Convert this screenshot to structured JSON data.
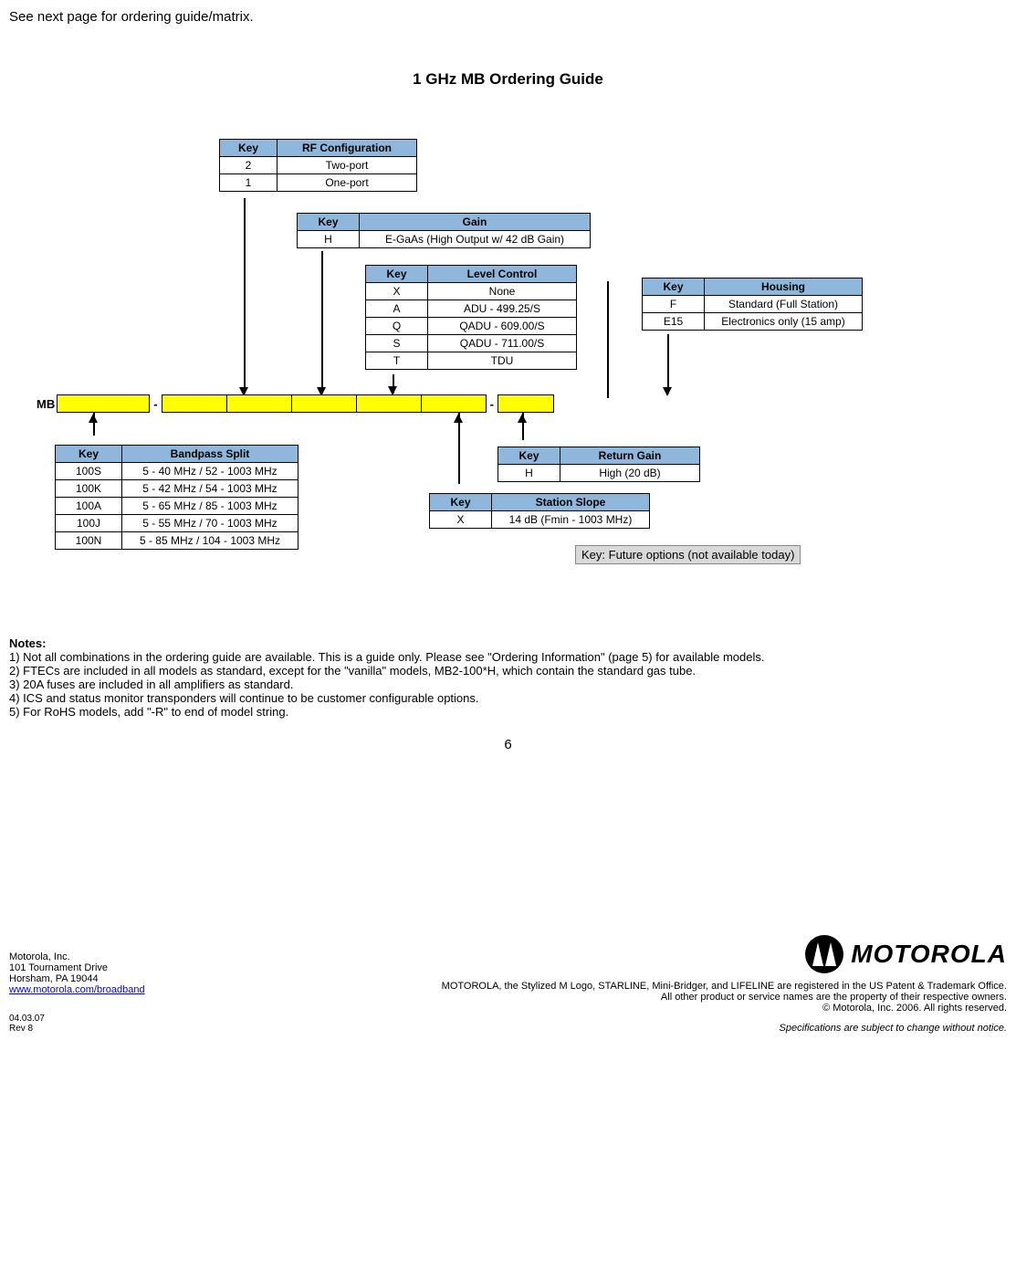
{
  "top_notice": "See next page for ordering guide/matrix.",
  "title": "1 GHz MB Ordering Guide",
  "rfconfig": {
    "headers": [
      "Key",
      "RF Configuration"
    ],
    "rows": [
      [
        "2",
        "Two-port"
      ],
      [
        "1",
        "One-port"
      ]
    ]
  },
  "gain": {
    "headers": [
      "Key",
      "Gain"
    ],
    "rows": [
      [
        "H",
        "E-GaAs (High Output w/ 42 dB Gain)"
      ]
    ]
  },
  "levelcontrol": {
    "headers": [
      "Key",
      "Level Control"
    ],
    "rows": [
      [
        "X",
        "None"
      ],
      [
        "A",
        "ADU - 499.25/S"
      ],
      [
        "Q",
        "QADU - 609.00/S"
      ],
      [
        "S",
        "QADU - 711.00/S"
      ],
      [
        "T",
        "TDU"
      ]
    ]
  },
  "housing": {
    "headers": [
      "Key",
      "Housing"
    ],
    "rows": [
      [
        "F",
        "Standard (Full Station)"
      ],
      [
        "E15",
        "Electronics only (15 amp)"
      ]
    ]
  },
  "bandpass": {
    "headers": [
      "Key",
      "Bandpass Split"
    ],
    "rows": [
      [
        "100S",
        "5 - 40 MHz / 52 - 1003 MHz"
      ],
      [
        "100K",
        "5 - 42 MHz / 54 - 1003 MHz"
      ],
      [
        "100A",
        "5 - 65 MHz / 85 - 1003 MHz"
      ],
      [
        "100J",
        "5 - 55 MHz / 70 - 1003 MHz"
      ],
      [
        "100N",
        "5 - 85 MHz / 104 - 1003 MHz"
      ]
    ]
  },
  "returngain": {
    "headers": [
      "Key",
      "Return Gain"
    ],
    "rows": [
      [
        "H",
        "High (20 dB)"
      ]
    ]
  },
  "stationslope": {
    "headers": [
      "Key",
      "Station Slope"
    ],
    "rows": [
      [
        "X",
        "14 dB (Fmin - 1003 MHz)"
      ]
    ]
  },
  "mb_label": "MB",
  "legend": "Key: Future options (not available today)",
  "notes_title": "Notes:",
  "notes": [
    "1) Not all combinations in the ordering guide are available.  This is a guide only.  Please see \"Ordering Information\" (page 5) for available models.",
    "2) FTECs are included in all models as standard, except for the \"vanilla\" models, MB2-100*H, which contain the standard gas tube.",
    "3) 20A fuses are included in all amplifiers as standard.",
    "4) ICS and status monitor transponders will continue to be customer configurable options.",
    "5) For RoHS models, add \"-R\" to end of model string."
  ],
  "page_number": "6",
  "footer_left": {
    "company": "Motorola, Inc.",
    "addr1": "101 Tournament Drive",
    "addr2": "Horsham, PA 19044",
    "url": "www.motorola.com/broadband"
  },
  "footer_right": {
    "logo_text": "MOTOROLA",
    "line1": "MOTOROLA, the Stylized M Logo, STARLINE, Mini-Bridger, and LIFELINE are registered in the US Patent & Trademark Office.",
    "line2": "All other product or service names are the property of their respective owners.",
    "line3": "© Motorola, Inc. 2006. All rights reserved.",
    "line4": "Specifications are subject to change without notice."
  },
  "rev": {
    "date": "04.03.07",
    "rev": "Rev 8"
  }
}
